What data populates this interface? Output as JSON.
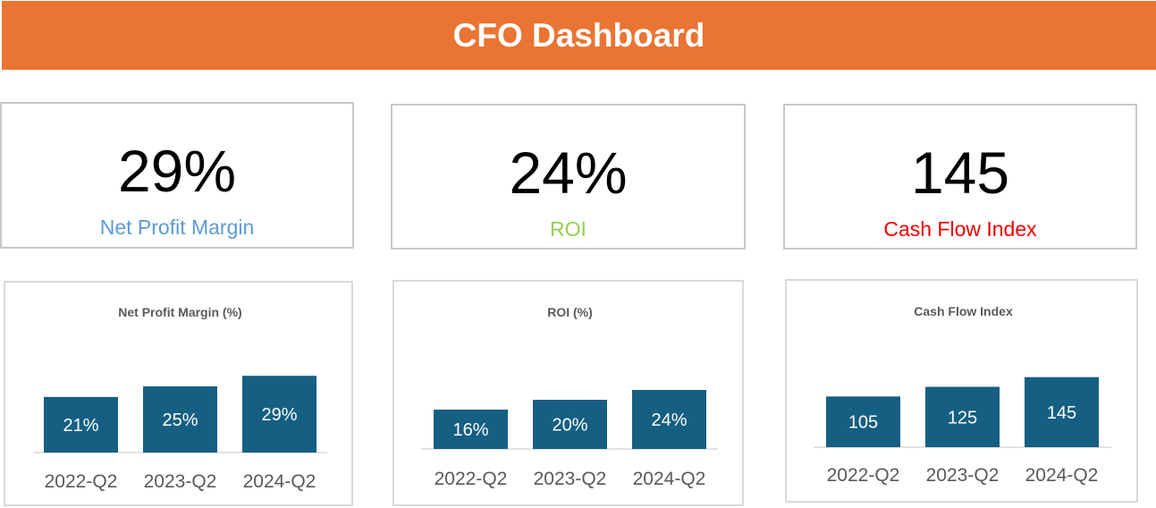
{
  "header": {
    "title": "CFO Dashboard",
    "color": "#EA7433"
  },
  "kpis": [
    {
      "value": "29%",
      "label": "Net Profit Margin",
      "color": "#5B9BD5"
    },
    {
      "value": "24%",
      "label": "ROI",
      "color": "#92D050"
    },
    {
      "value": "145",
      "label": "Cash Flow Index",
      "color": "#EE0000"
    }
  ],
  "bar_color": "#155F82",
  "chart_data": [
    {
      "type": "bar",
      "title": "Net Profit Margin (%)",
      "categories": [
        "2022-Q2",
        "2023-Q2",
        "2024-Q2"
      ],
      "values": [
        21,
        25,
        29
      ],
      "data_labels": [
        "21%",
        "25%",
        "29%"
      ],
      "ylim": [
        0,
        40
      ],
      "grid": false
    },
    {
      "type": "bar",
      "title": "ROI (%)",
      "categories": [
        "2022-Q2",
        "2023-Q2",
        "2024-Q2"
      ],
      "values": [
        16,
        20,
        24
      ],
      "data_labels": [
        "16%",
        "20%",
        "24%"
      ],
      "ylim": [
        0,
        40
      ],
      "grid": false
    },
    {
      "type": "bar",
      "title": "Cash Flow Index",
      "categories": [
        "2022-Q2",
        "2023-Q2",
        "2024-Q2"
      ],
      "values": [
        105,
        125,
        145
      ],
      "data_labels": [
        "105",
        "125",
        "145"
      ],
      "ylim": [
        0,
        200
      ],
      "grid": false
    }
  ]
}
